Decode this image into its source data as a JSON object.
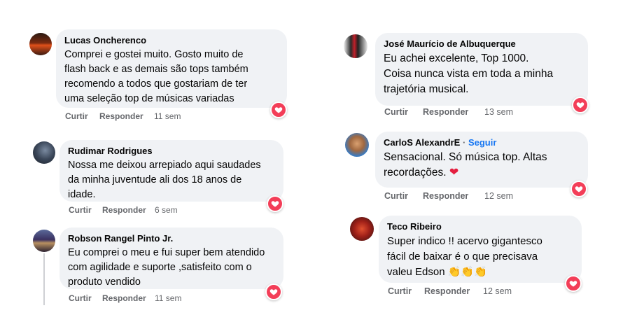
{
  "comments": [
    {
      "author": "Lucas Oncherenco",
      "text": "Comprei e gostei muito. Gosto muito de\nflash back e as demais são tops também\nrecomendo a todos que gostariam de ter\numa seleção top de músicas variadas",
      "like": "Curtir",
      "reply": "Responder",
      "time": "11 sem"
    },
    {
      "author": "Rudimar Rodrigues",
      "text": "Nossa me deixou arrepiado aqui saudades\nda minha juventude ali dos 18 anos de\nidade.",
      "like": "Curtir",
      "reply": "Responder",
      "time": "6 sem"
    },
    {
      "author": "Robson Rangel Pinto Jr.",
      "text": "Eu comprei o meu e fui super bem atendido\ncom agilidade e suporte ,satisfeito com o\nproduto vendido",
      "like": "Curtir",
      "reply": "Responder",
      "time": "11 sem"
    },
    {
      "author": "José Maurício de Albuquerque",
      "text": "Eu achei excelente, Top 1000.\nCoisa nunca vista em toda a minha\ntrajetória musical.",
      "like": "Curtir",
      "reply": "Responder",
      "time": "13 sem"
    },
    {
      "author": "CarloS AlexandrE",
      "follow": "Seguir",
      "dot": "·",
      "text": "Sensacional. Só música top. Altas\nrecordações.",
      "like": "Curtir",
      "reply": "Responder",
      "time": "12 sem"
    },
    {
      "author": "Teco Ribeiro",
      "text": "Super indico !! acervo gigantesco\nfácil de baixar é o que precisava\nvaleu Edson",
      "like": "Curtir",
      "reply": "Responder",
      "time": "12 sem"
    }
  ],
  "icons": {
    "reaction": "heart-icon",
    "emoji_heart": "red-heart-emoji",
    "emoji_clap": "clapping-hands-emoji"
  },
  "colors": {
    "bubble": "#f0f2f5",
    "heart": "#f33e58",
    "follow_link": "#1877f2",
    "meta": "#65676b"
  }
}
